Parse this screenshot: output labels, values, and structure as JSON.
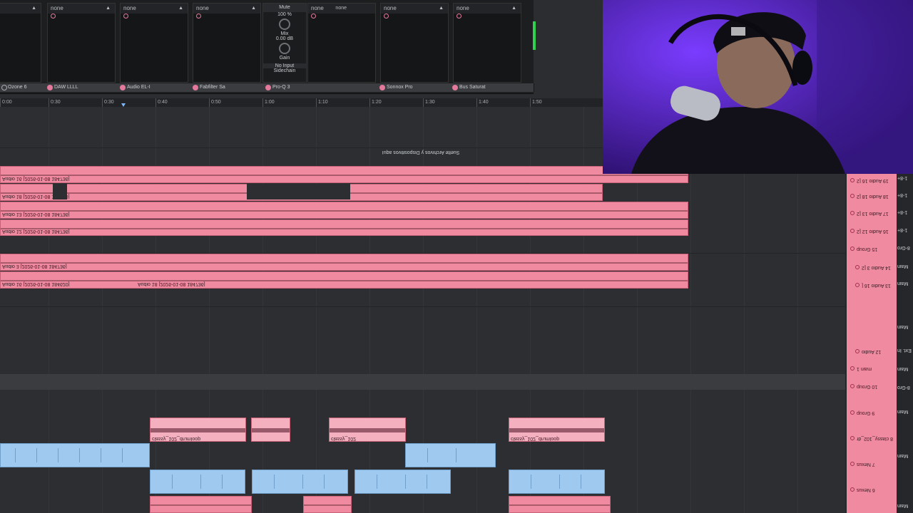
{
  "rack": {
    "slots": [
      {
        "name": "none"
      },
      {
        "name": "none"
      },
      {
        "name": "none"
      },
      {
        "name": "none"
      },
      {
        "name": "none"
      },
      {
        "name": "none"
      },
      {
        "name": "none"
      },
      {
        "name": "none"
      },
      {
        "name": "none"
      },
      {
        "name": "none"
      },
      {
        "name": "none"
      }
    ],
    "devices": [
      "Ozone 6",
      "DAW LLLL",
      "Audio EL-I",
      "Fabfilter Sa",
      "Pro-Q 3",
      "Sonnox Pro",
      "Bus Saturat"
    ],
    "sidechain": {
      "title": "Mute",
      "knob1_label": "Mix",
      "value1": "100 %",
      "value2": "0.00 dB",
      "knob2_label": "Gain",
      "sidechain_label": "Sidechain",
      "input_select": "No Input"
    }
  },
  "ruler": {
    "ticks": [
      "0:00",
      "0:30",
      "0:30",
      "0:40",
      "0:50",
      "1:00",
      "1:10",
      "1:20",
      "1:30",
      "1:40",
      "1:50"
    ]
  },
  "arrangement": {
    "drop_text": "Suelte Archivos y Dispositivos aquí",
    "clips": [
      {
        "label": "Audio 16 [2026-01-08 184736]"
      },
      {
        "label": "Audio 18 [2026-01-08 184736]"
      },
      {
        "label": "Audio 13 [2026-01-08 184736]"
      },
      {
        "label": "Audio 12 [2026-01-08 184736]"
      },
      {
        "label": "Audio 3 [2026-01-08 184736]"
      },
      {
        "label": "Audio 16 [2026-01-08 184620]"
      },
      {
        "label": "Audio 18 [2026-01-08 184736]"
      }
    ],
    "beat_labels": [
      "classy_102_drumloop",
      "classy_102_drumloop",
      "classy_102",
      "classy_102_drumloop"
    ]
  },
  "tracks": [
    {
      "name": "19 Audio 16 [2"
    },
    {
      "name": "18 Audio 18 [2"
    },
    {
      "name": "17 Audio 13 [2"
    },
    {
      "name": "16 Audio 12 [2"
    },
    {
      "name": "15 Group"
    },
    {
      "name": "14 Audio 3 [2"
    },
    {
      "name": "13 Audio 16 ["
    },
    {
      "name": "12 Audio"
    },
    {
      "name": "main 1"
    },
    {
      "name": "10 Group"
    },
    {
      "name": "9 Group"
    },
    {
      "name": "8 classy_102_dr"
    },
    {
      "name": "7 Nexus"
    },
    {
      "name": "6 Nexus"
    }
  ],
  "io": [
    "1-8+",
    "1-8+",
    "1-8+",
    "1-8+",
    "8-Gro",
    "Main",
    "Main",
    "Main",
    "Ext. In",
    "Main",
    "8-Gro",
    "Main",
    "Main",
    "Main"
  ]
}
